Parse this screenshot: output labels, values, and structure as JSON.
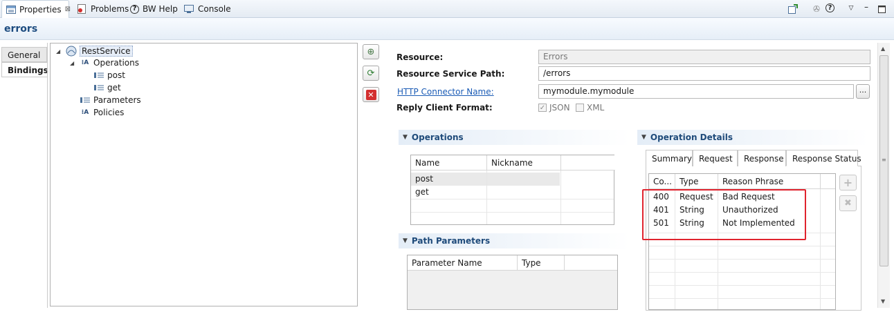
{
  "tabs": {
    "properties": "Properties",
    "problems": "Problems",
    "bw_help": "BW Help",
    "console": "Console"
  },
  "header": {
    "title": "errors"
  },
  "left_tabs": {
    "general": "General",
    "bindings": "Bindings"
  },
  "tree": {
    "root": "RestService",
    "operations": "Operations",
    "post": "post",
    "get": "get",
    "parameters": "Parameters",
    "policies": "Policies"
  },
  "form": {
    "resource_label": "Resource:",
    "resource_value": "Errors",
    "path_label": "Resource Service Path:",
    "path_value": "/errors",
    "connector_label": "HTTP Connector Name:",
    "connector_value": "mymodule.mymodule",
    "browse_label": "...",
    "format_label": "Reply Client Format:",
    "json_label": "JSON",
    "xml_label": "XML",
    "json_checked": true,
    "xml_checked": false
  },
  "operations_section": {
    "title": "Operations",
    "columns": [
      "Name",
      "Nickname"
    ],
    "rows": [
      "post",
      "get"
    ]
  },
  "path_params_section": {
    "title": "Path Parameters",
    "columns": [
      "Parameter Name",
      "Type"
    ]
  },
  "op_details_section": {
    "title": "Operation Details",
    "tabs": [
      "Summary",
      "Request",
      "Response",
      "Response Status"
    ],
    "active_tab": "Response Status",
    "columns": [
      "Co...",
      "Type",
      "Reason Phrase"
    ],
    "rows": [
      {
        "code": "400",
        "type": "Request",
        "reason": "Bad Request"
      },
      {
        "code": "401",
        "type": "String",
        "reason": "Unauthorized"
      },
      {
        "code": "501",
        "type": "String",
        "reason": "Not Implemented"
      }
    ]
  },
  "colors": {
    "highlight": "#e0232e",
    "link": "#1a5bb5",
    "title": "#1d4c80"
  }
}
